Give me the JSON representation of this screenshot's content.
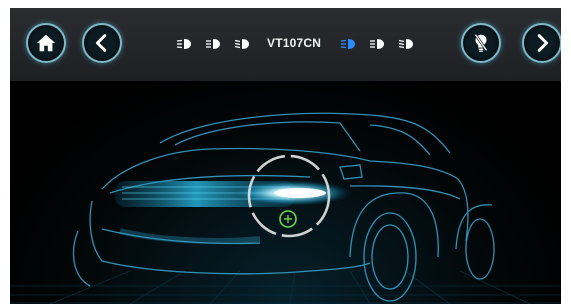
{
  "header": {
    "home_button": "home",
    "back_button": "back",
    "model_title": "VT107CN",
    "light_icons_left": [
      "headlight-icon",
      "headlight-icon",
      "headlight-icon"
    ],
    "light_icons_right": [
      "headlight-icon-active",
      "headlight-icon",
      "headlight-icon"
    ],
    "bulb_button": "bulb-off",
    "next_button": "next"
  },
  "scene": {
    "subject": "car-wireframe",
    "target": "headlight-target"
  },
  "colors": {
    "accent": "#2aa8d8",
    "active_icon": "#1e90ff",
    "target_ring": "#e6e6e6",
    "target_center": "#6cd94a",
    "topbar": "#25272b"
  }
}
